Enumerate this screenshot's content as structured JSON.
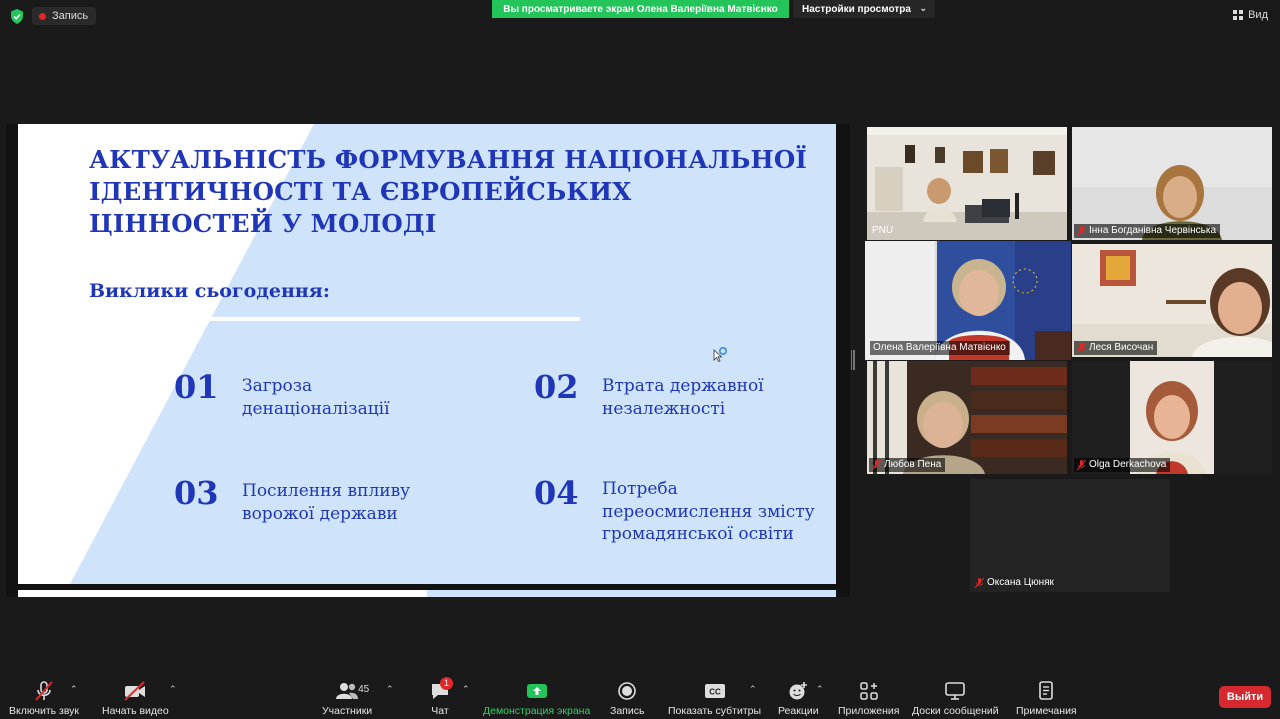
{
  "topbar": {
    "record_label": "Запись",
    "share_banner": "Вы просматриваете экран Олена Валеріївна Матвієнко",
    "view_options_label": "Настройки просмотра",
    "view_label": "Вид"
  },
  "slide": {
    "title": "АКТУАЛЬНІСТЬ ФОРМУВАННЯ НАЦІОНАЛЬНОЇ ІДЕНТИЧНОСТІ ТА ЄВРОПЕЙСЬКИХ ЦІННОСТЕЙ У МОЛОДІ",
    "subtitle": "Виклики сьогодення:",
    "items": [
      {
        "num": "01",
        "text": "Загроза денаціоналізації"
      },
      {
        "num": "02",
        "text": "Втрата державної незалежності"
      },
      {
        "num": "03",
        "text": "Посилення впливу ворожої держави"
      },
      {
        "num": "04",
        "text": "Потреба переосмислення змісту громадянської освіти"
      }
    ],
    "colors": {
      "accent": "#1f36b8",
      "background": "#cfe4fb"
    }
  },
  "participants": [
    {
      "name": "PNU",
      "muted": false
    },
    {
      "name": "Інна Богданівна Червінська",
      "muted": true
    },
    {
      "name": "Олена Валеріївна Матвієнко",
      "muted": false,
      "active": true
    },
    {
      "name": "Леся Височан",
      "muted": true
    },
    {
      "name": "Любов Пена",
      "muted": true
    },
    {
      "name": "Olga Derkachova",
      "muted": true
    },
    {
      "name": "Оксана Цюняк",
      "muted": true
    }
  ],
  "toolbar": {
    "unmute_label": "Включить звук",
    "video_label": "Начать видео",
    "participants_label": "Участники",
    "participants_count": "45",
    "chat_label": "Чат",
    "chat_badge": "1",
    "share_label": "Демонстрация экрана",
    "record_label": "Запись",
    "captions_label": "Показать субтитры",
    "captions_icon_text": "CC",
    "reactions_label": "Реакции",
    "apps_label": "Приложения",
    "whiteboards_label": "Доски сообщений",
    "notes_label": "Примечания",
    "leave_label": "Выйти"
  }
}
